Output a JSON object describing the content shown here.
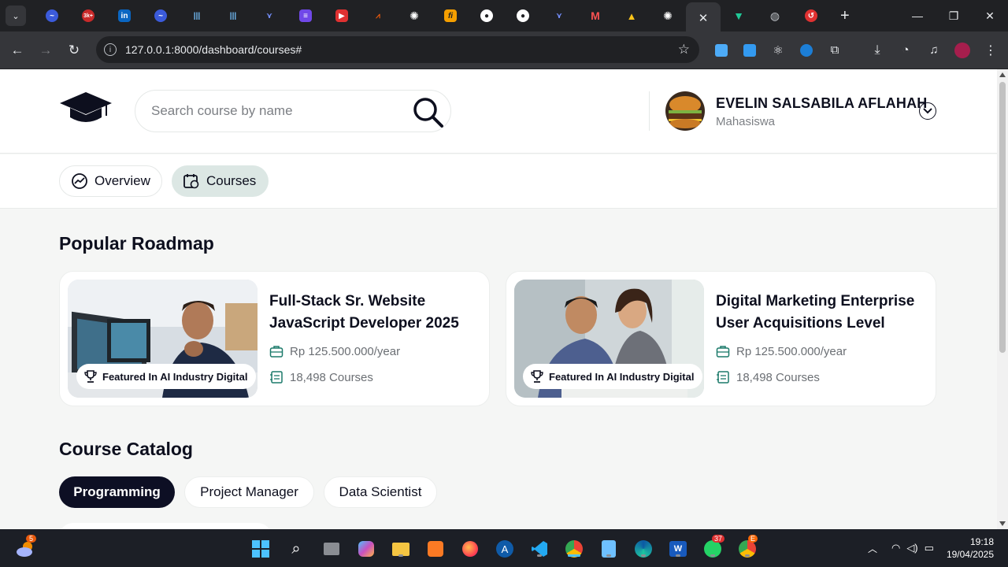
{
  "browser": {
    "active_tab_close": "✕",
    "new_tab": "+",
    "url": "127.0.0.1:8000/dashboard/courses#",
    "window": {
      "minimize": "—",
      "maximize": "❐",
      "close": "✕"
    }
  },
  "header": {
    "search_placeholder": "Search course by name",
    "user_name": "EVELIN SALSABILA AFLAHAH",
    "user_role": "Mahasiswa"
  },
  "tabs": [
    {
      "label": "Overview",
      "icon": "chart-trend-icon",
      "active": false
    },
    {
      "label": "Courses",
      "icon": "calendar-course-icon",
      "active": true
    }
  ],
  "popular": {
    "heading": "Popular Roadmap",
    "cards": [
      {
        "title": "Full-Stack Sr. Website JavaScript Developer 2025",
        "badge": "Featured In AI Industry Digital",
        "price": "Rp 125.500.000/year",
        "courses": "18,498 Courses"
      },
      {
        "title": "Digital Marketing Enterprise User Acquisitions Level",
        "badge": "Featured In AI Industry Digital",
        "price": "Rp 125.500.000/year",
        "courses": "18,498 Courses"
      }
    ]
  },
  "catalog": {
    "heading": "Course Catalog",
    "categories": [
      "Programming",
      "Project Manager",
      "Data Scientist"
    ],
    "active": "Programming"
  },
  "taskbar": {
    "weather_badge": "5",
    "whatsapp_badge": "37",
    "chrome2_badge": "E",
    "time": "19:18",
    "date": "19/04/2025"
  },
  "colors": {
    "primary_dark": "#0d0f24",
    "active_tab_bg": "#dce7e4",
    "page_bg": "#f5f6f5"
  }
}
